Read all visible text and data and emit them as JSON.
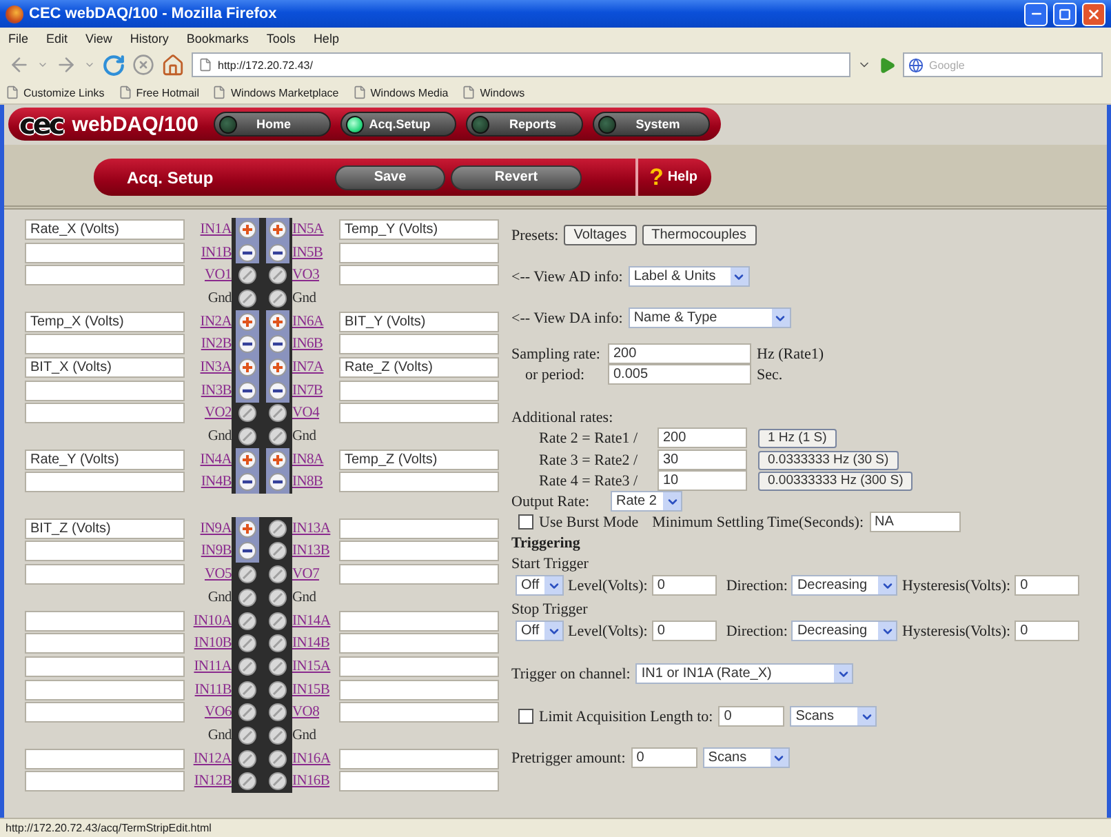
{
  "window": {
    "title": "CEC webDAQ/100 - Mozilla Firefox"
  },
  "menu": [
    "File",
    "Edit",
    "View",
    "History",
    "Bookmarks",
    "Tools",
    "Help"
  ],
  "address": {
    "url": "http://172.20.72.43/"
  },
  "search": {
    "placeholder": "Google"
  },
  "bookmarks": [
    "Customize Links",
    "Free Hotmail",
    "Windows Marketplace",
    "Windows Media",
    "Windows"
  ],
  "app": {
    "logo": "cec",
    "product": "webDAQ/100",
    "nav": [
      {
        "label": "Home",
        "selected": false
      },
      {
        "label": "Acq.Setup",
        "selected": true
      },
      {
        "label": "Reports",
        "selected": false
      },
      {
        "label": "System",
        "selected": false
      }
    ]
  },
  "toolbar": {
    "title": "Acq. Setup",
    "buttons": [
      "Save",
      "Revert"
    ],
    "help": {
      "icon": "?",
      "label": "Help"
    }
  },
  "terminal_strip": [
    [
      {
        "left": {
          "label": "IN1A",
          "kind": "channel",
          "terminal": {
            "kind": "plus"
          },
          "value": "Rate_X (Volts)"
        },
        "right": {
          "label": "IN5A",
          "kind": "channel",
          "terminal": {
            "kind": "plus"
          },
          "value": "Temp_Y (Volts)"
        }
      },
      {
        "left": {
          "label": "IN1B",
          "kind": "channel",
          "terminal": {
            "kind": "minus"
          }
        },
        "right": {
          "label": "IN5B",
          "kind": "channel",
          "terminal": {
            "kind": "minus"
          }
        }
      },
      {
        "left": {
          "label": "VO1",
          "kind": "channel",
          "terminal": {
            "kind": "plain"
          }
        },
        "right": {
          "label": "VO3",
          "kind": "channel",
          "terminal": {
            "kind": "plain"
          }
        }
      },
      {
        "left": {
          "label": "Gnd",
          "kind": "gnd",
          "terminal": {
            "kind": "plain"
          }
        },
        "right": {
          "label": "Gnd",
          "kind": "gnd",
          "terminal": {
            "kind": "plain"
          }
        }
      },
      {
        "left": {
          "label": "IN2A",
          "kind": "channel",
          "terminal": {
            "kind": "plus"
          },
          "value": "Temp_X (Volts)"
        },
        "right": {
          "label": "IN6A",
          "kind": "channel",
          "terminal": {
            "kind": "plus"
          },
          "value": "BIT_Y (Volts)"
        }
      },
      {
        "left": {
          "label": "IN2B",
          "kind": "channel",
          "terminal": {
            "kind": "minus"
          }
        },
        "right": {
          "label": "IN6B",
          "kind": "channel",
          "terminal": {
            "kind": "minus"
          }
        }
      },
      {
        "left": {
          "label": "IN3A",
          "kind": "channel",
          "terminal": {
            "kind": "plus"
          },
          "value": "BIT_X (Volts)"
        },
        "right": {
          "label": "IN7A",
          "kind": "channel",
          "terminal": {
            "kind": "plus"
          },
          "value": "Rate_Z (Volts)"
        }
      },
      {
        "left": {
          "label": "IN3B",
          "kind": "channel",
          "terminal": {
            "kind": "minus"
          }
        },
        "right": {
          "label": "IN7B",
          "kind": "channel",
          "terminal": {
            "kind": "minus"
          }
        }
      },
      {
        "left": {
          "label": "VO2",
          "kind": "channel",
          "terminal": {
            "kind": "plain"
          }
        },
        "right": {
          "label": "VO4",
          "kind": "channel",
          "terminal": {
            "kind": "plain"
          }
        }
      },
      {
        "left": {
          "label": "Gnd",
          "kind": "gnd",
          "terminal": {
            "kind": "plain"
          }
        },
        "right": {
          "label": "Gnd",
          "kind": "gnd",
          "terminal": {
            "kind": "plain"
          }
        }
      },
      {
        "left": {
          "label": "IN4A",
          "kind": "channel",
          "terminal": {
            "kind": "plus"
          },
          "value": "Rate_Y (Volts)"
        },
        "right": {
          "label": "IN8A",
          "kind": "channel",
          "terminal": {
            "kind": "plus"
          },
          "value": "Temp_Z (Volts)"
        }
      },
      {
        "left": {
          "label": "IN4B",
          "kind": "channel",
          "terminal": {
            "kind": "minus"
          }
        },
        "right": {
          "label": "IN8B",
          "kind": "channel",
          "terminal": {
            "kind": "minus"
          }
        }
      }
    ],
    [
      {
        "left": {
          "label": "IN9A",
          "kind": "channel",
          "terminal": {
            "kind": "plus"
          },
          "value": "BIT_Z (Volts)"
        },
        "right": {
          "label": "IN13A",
          "kind": "channel",
          "terminal": {
            "kind": "plain"
          }
        }
      },
      {
        "left": {
          "label": "IN9B",
          "kind": "channel",
          "terminal": {
            "kind": "minus"
          }
        },
        "right": {
          "label": "IN13B",
          "kind": "channel",
          "terminal": {
            "kind": "plain"
          }
        }
      },
      {
        "left": {
          "label": "VO5",
          "kind": "channel",
          "terminal": {
            "kind": "plain"
          }
        },
        "right": {
          "label": "VO7",
          "kind": "channel",
          "terminal": {
            "kind": "plain"
          }
        }
      },
      {
        "left": {
          "label": "Gnd",
          "kind": "gnd",
          "terminal": {
            "kind": "plain"
          }
        },
        "right": {
          "label": "Gnd",
          "kind": "gnd",
          "terminal": {
            "kind": "plain"
          }
        }
      },
      {
        "left": {
          "label": "IN10A",
          "kind": "channel",
          "terminal": {
            "kind": "plain"
          }
        },
        "right": {
          "label": "IN14A",
          "kind": "channel",
          "terminal": {
            "kind": "plain"
          }
        }
      },
      {
        "left": {
          "label": "IN10B",
          "kind": "channel",
          "terminal": {
            "kind": "plain"
          }
        },
        "right": {
          "label": "IN14B",
          "kind": "channel",
          "terminal": {
            "kind": "plain"
          }
        }
      },
      {
        "left": {
          "label": "IN11A",
          "kind": "channel",
          "terminal": {
            "kind": "plain"
          }
        },
        "right": {
          "label": "IN15A",
          "kind": "channel",
          "terminal": {
            "kind": "plain"
          }
        }
      },
      {
        "left": {
          "label": "IN11B",
          "kind": "channel",
          "terminal": {
            "kind": "plain"
          }
        },
        "right": {
          "label": "IN15B",
          "kind": "channel",
          "terminal": {
            "kind": "plain"
          }
        }
      },
      {
        "left": {
          "label": "VO6",
          "kind": "channel",
          "terminal": {
            "kind": "plain"
          }
        },
        "right": {
          "label": "VO8",
          "kind": "channel",
          "terminal": {
            "kind": "plain"
          }
        }
      },
      {
        "left": {
          "label": "Gnd",
          "kind": "gnd",
          "terminal": {
            "kind": "plain"
          }
        },
        "right": {
          "label": "Gnd",
          "kind": "gnd",
          "terminal": {
            "kind": "plain"
          }
        }
      },
      {
        "left": {
          "label": "IN12A",
          "kind": "channel",
          "terminal": {
            "kind": "plain"
          }
        },
        "right": {
          "label": "IN16A",
          "kind": "channel",
          "terminal": {
            "kind": "plain"
          }
        }
      },
      {
        "left": {
          "label": "IN12B",
          "kind": "channel",
          "terminal": {
            "kind": "plain"
          }
        },
        "right": {
          "label": "IN16B",
          "kind": "channel",
          "terminal": {
            "kind": "plain"
          }
        }
      }
    ]
  ],
  "settings": {
    "presets": {
      "label": "Presets:",
      "buttons": [
        "Voltages",
        "Thermocouples"
      ]
    },
    "ad_info": {
      "label": "<-- View AD info:",
      "value": "Label & Units"
    },
    "da_info": {
      "label": "<-- View DA info:",
      "value": "Name & Type"
    },
    "sampling": {
      "label": "Sampling rate:",
      "value": "200",
      "unit": "Hz (Rate1)"
    },
    "period": {
      "label": "or period:",
      "value": "0.005",
      "unit": "Sec."
    },
    "additional_rates": {
      "label": "Additional rates:",
      "rates": [
        {
          "label": "Rate 2 = Rate1 /",
          "value": "200",
          "result": "1 Hz (1 S)"
        },
        {
          "label": "Rate 3 = Rate2 /",
          "value": "30",
          "result": "0.0333333 Hz (30 S)"
        },
        {
          "label": "Rate 4 = Rate3 /",
          "value": "10",
          "result": "0.00333333 Hz (300 S)"
        }
      ]
    },
    "output_rate": {
      "label": "Output Rate:",
      "value": "Rate 2"
    },
    "burst": {
      "label": "Use Burst Mode",
      "checked": false,
      "settling_label": "Minimum Settling Time(Seconds):",
      "settling_value": "NA"
    },
    "triggering": {
      "title": "Triggering",
      "triggers": [
        {
          "title": "Start Trigger",
          "mode": "Off",
          "level_label": "Level(Volts):",
          "level": "0",
          "direction_label": "Direction:",
          "direction": "Decreasing",
          "hysteresis_label": "Hysteresis(Volts):",
          "hysteresis": "0"
        },
        {
          "title": "Stop Trigger",
          "mode": "Off",
          "level_label": "Level(Volts):",
          "level": "0",
          "direction_label": "Direction:",
          "direction": "Decreasing",
          "hysteresis_label": "Hysteresis(Volts):",
          "hysteresis": "0"
        }
      ]
    },
    "trigger_channel": {
      "label": "Trigger on channel:",
      "value": "IN1 or IN1A (Rate_X)"
    },
    "limit": {
      "label": "Limit Acquisition Length to:",
      "checked": false,
      "value": "0",
      "unit": "Scans"
    },
    "pretrigger": {
      "label": "Pretrigger amount:",
      "value": "0",
      "unit": "Scans"
    }
  },
  "status_bar": "http://172.20.72.43/acq/TermStripEdit.html"
}
